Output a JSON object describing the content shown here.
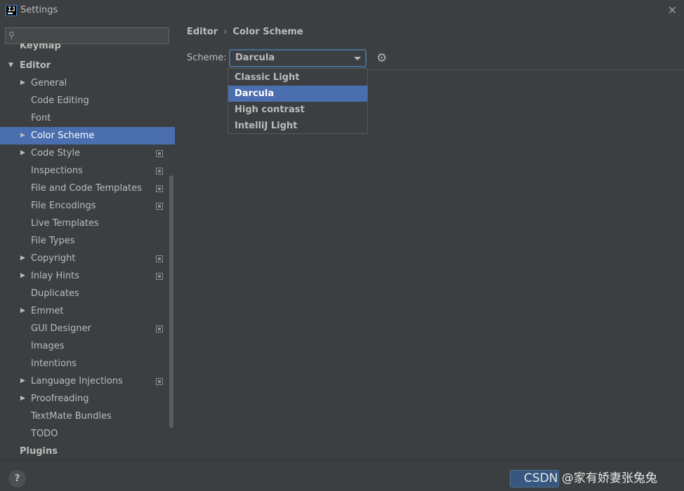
{
  "window": {
    "title": "Settings",
    "close_glyph": "✕",
    "app_icon_letter": "IJ"
  },
  "search": {
    "placeholder": "",
    "icon": "search-icon"
  },
  "sidebar": {
    "partial_item": "Keymap",
    "editor_label": "Editor",
    "children": [
      {
        "label": "General",
        "expandable": true,
        "project_icon": false
      },
      {
        "label": "Code Editing",
        "expandable": false,
        "project_icon": false
      },
      {
        "label": "Font",
        "expandable": false,
        "project_icon": false
      },
      {
        "label": "Color Scheme",
        "expandable": true,
        "project_icon": false,
        "selected": true
      },
      {
        "label": "Code Style",
        "expandable": true,
        "project_icon": true
      },
      {
        "label": "Inspections",
        "expandable": false,
        "project_icon": true
      },
      {
        "label": "File and Code Templates",
        "expandable": false,
        "project_icon": true
      },
      {
        "label": "File Encodings",
        "expandable": false,
        "project_icon": true
      },
      {
        "label": "Live Templates",
        "expandable": false,
        "project_icon": false
      },
      {
        "label": "File Types",
        "expandable": false,
        "project_icon": false
      },
      {
        "label": "Copyright",
        "expandable": true,
        "project_icon": true
      },
      {
        "label": "Inlay Hints",
        "expandable": true,
        "project_icon": true
      },
      {
        "label": "Duplicates",
        "expandable": false,
        "project_icon": false
      },
      {
        "label": "Emmet",
        "expandable": true,
        "project_icon": false
      },
      {
        "label": "GUI Designer",
        "expandable": false,
        "project_icon": true
      },
      {
        "label": "Images",
        "expandable": false,
        "project_icon": false
      },
      {
        "label": "Intentions",
        "expandable": false,
        "project_icon": false
      },
      {
        "label": "Language Injections",
        "expandable": true,
        "project_icon": true
      },
      {
        "label": "Proofreading",
        "expandable": true,
        "project_icon": false
      },
      {
        "label": "TextMate Bundles",
        "expandable": false,
        "project_icon": false
      },
      {
        "label": "TODO",
        "expandable": false,
        "project_icon": false
      }
    ],
    "plugins_label": "Plugins"
  },
  "breadcrumb": {
    "parent": "Editor",
    "separator": "›",
    "current": "Color Scheme"
  },
  "scheme": {
    "label": "Scheme:",
    "selected": "Darcula",
    "options": [
      "Classic Light",
      "Darcula",
      "High contrast",
      "IntelliJ Light"
    ],
    "gear_icon": "gear-icon"
  },
  "footer": {
    "help_label": "?",
    "watermark": "CSDN @家有娇妻张兔兔"
  },
  "colors": {
    "background": "#3c3f41",
    "selection": "#4b6eaf",
    "text": "#bbbbbb"
  }
}
